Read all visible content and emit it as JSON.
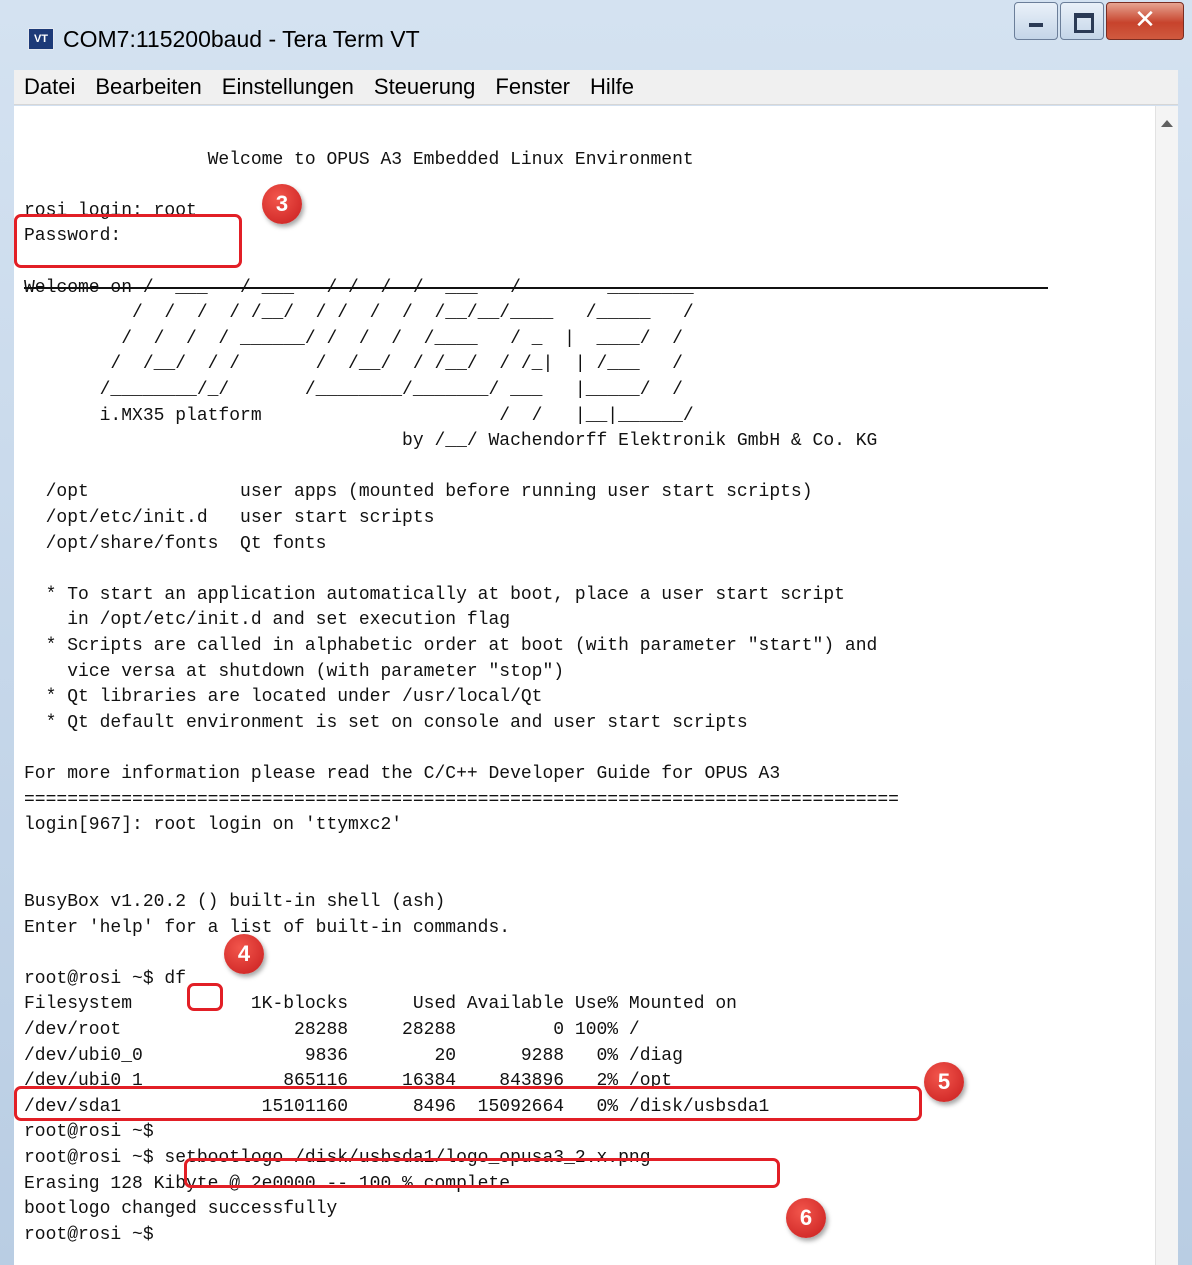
{
  "window": {
    "title": "COM7:115200baud - Tera Term VT",
    "icon_label": "VT",
    "buttons": {
      "minimize": "minimize-icon",
      "maximize": "maximize-icon",
      "close": "close-icon"
    }
  },
  "menu": [
    "Datei",
    "Bearbeiten",
    "Einstellungen",
    "Steuerung",
    "Fenster",
    "Hilfe"
  ],
  "terminal": {
    "lines": [
      "",
      "                 Welcome to OPUS A3 Embedded Linux Environment",
      "",
      "rosi login: root",
      "Password:",
      "",
      "Welcome on /  ___   / ___   / /  /  /  ___   /        ________",
      "          /  /  /  / /__/  / /  /  /  /__/__/____   /_____   /",
      "         /  /  /  / ______/ /  /  /  /____   / _  |  ____/  /",
      "        /  /__/  / /       /  /__/  / /__/  / /_|  | /___   /",
      "       /________/_/       /________/_______/ ___   |_____/  /",
      "       i.MX35 platform                      /  /   |__|______/",
      "                                   by /__/ Wachendorff Elektronik GmbH & Co. KG",
      "",
      "  /opt              user apps (mounted before running user start scripts)",
      "  /opt/etc/init.d   user start scripts",
      "  /opt/share/fonts  Qt fonts",
      "",
      "  * To start an application automatically at boot, place a user start script",
      "    in /opt/etc/init.d and set execution flag",
      "  * Scripts are called in alphabetic order at boot (with parameter \"start\") and",
      "    vice versa at shutdown (with parameter \"stop\")",
      "  * Qt libraries are located under /usr/local/Qt",
      "  * Qt default environment is set on console and user start scripts",
      "",
      "For more information please read the C/C++ Developer Guide for OPUS A3",
      "=================================================================================",
      "login[967]: root login on 'ttymxc2'",
      "",
      "",
      "BusyBox v1.20.2 () built-in shell (ash)",
      "Enter 'help' for a list of built-in commands.",
      "",
      "root@rosi ~$ df",
      "Filesystem           1K-blocks      Used Available Use% Mounted on",
      "/dev/root                28288     28288         0 100% /",
      "/dev/ubi0_0               9836        20      9288   0% /diag",
      "/dev/ubi0_1             865116     16384    843896   2% /opt",
      "/dev/sda1             15101160      8496  15092664   0% /disk/usbsda1",
      "root@rosi ~$",
      "root@rosi ~$ setbootlogo /disk/usbsda1/logo_opusa3_2.x.png",
      "Erasing 128 Kibyte @ 2e0000 -- 100 % complete",
      "bootlogo changed successfully",
      "root@rosi ~$"
    ]
  },
  "annotations": {
    "badge_3": "3",
    "badge_4": "4",
    "badge_5": "5",
    "badge_6": "6"
  },
  "colors": {
    "accent_red": "#e21f26",
    "terminal_bg": "#ffffff",
    "terminal_fg": "#111111",
    "frame": "#c9d7e7"
  }
}
